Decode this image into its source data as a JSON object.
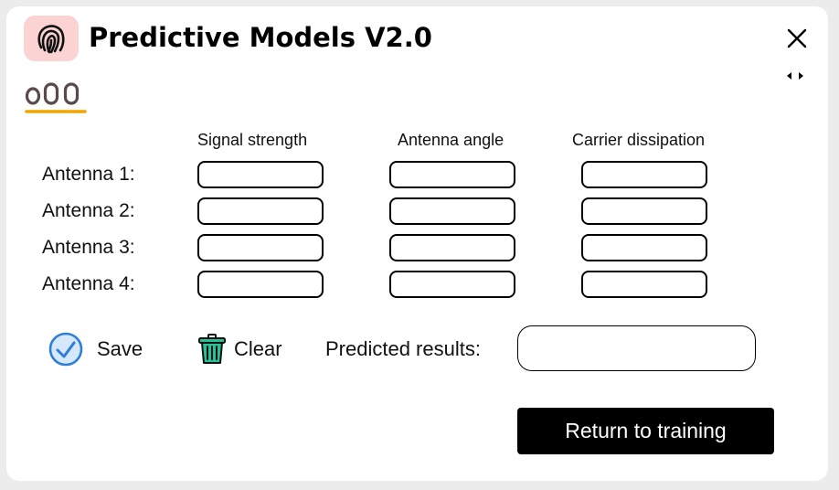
{
  "window": {
    "title": "Predictive Models V2.0",
    "logo_icon": "fingerprint-icon",
    "close_icon": "close-icon",
    "resize_icon": "resize-arrows-icon",
    "brand_glyph": "oOo",
    "brand_underline_color": "#f0a500"
  },
  "grid": {
    "columns": [
      "Signal strength",
      "Antenna angle",
      "Carrier dissipation"
    ],
    "rows": [
      {
        "label": "Antenna 1:",
        "values": [
          "",
          "",
          ""
        ]
      },
      {
        "label": "Antenna 2:",
        "values": [
          "",
          "",
          ""
        ]
      },
      {
        "label": "Antenna 3:",
        "values": [
          "",
          "",
          ""
        ]
      },
      {
        "label": "Antenna 4:",
        "values": [
          "",
          "",
          ""
        ]
      }
    ]
  },
  "actions": {
    "save_label": "Save",
    "save_icon": "check-circle-icon",
    "clear_label": "Clear",
    "clear_icon": "trash-icon"
  },
  "prediction": {
    "label": "Predicted results:",
    "value": ""
  },
  "return_button": {
    "label": "Return to training"
  },
  "colors": {
    "logo_bg": "#fbd3d3",
    "save_icon": "#2f7fd6",
    "clear_icon": "#2bbf95",
    "return_bg": "#000000",
    "return_text": "#ffffff"
  }
}
